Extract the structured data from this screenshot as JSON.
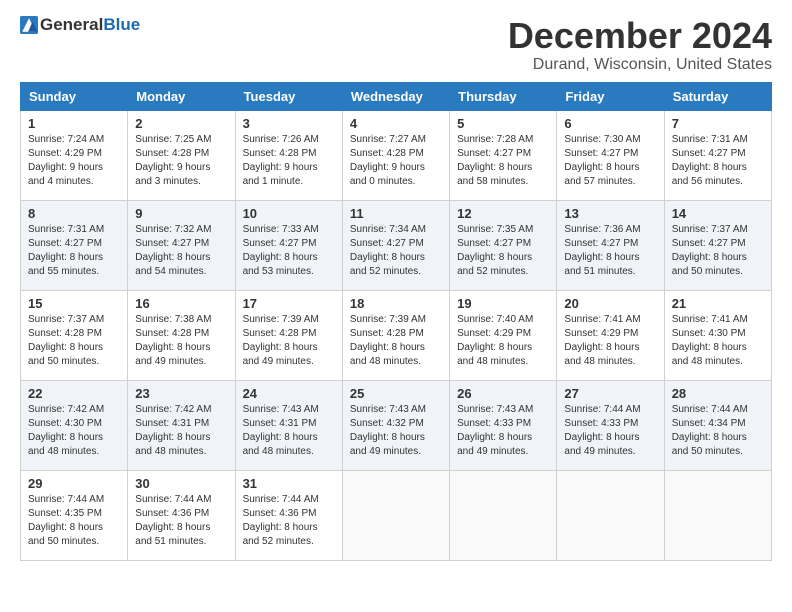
{
  "logo": {
    "general": "General",
    "blue": "Blue"
  },
  "header": {
    "month": "December 2024",
    "location": "Durand, Wisconsin, United States"
  },
  "weekdays": [
    "Sunday",
    "Monday",
    "Tuesday",
    "Wednesday",
    "Thursday",
    "Friday",
    "Saturday"
  ],
  "weeks": [
    [
      {
        "day": "1",
        "sunrise": "Sunrise: 7:24 AM",
        "sunset": "Sunset: 4:29 PM",
        "daylight": "Daylight: 9 hours and 4 minutes."
      },
      {
        "day": "2",
        "sunrise": "Sunrise: 7:25 AM",
        "sunset": "Sunset: 4:28 PM",
        "daylight": "Daylight: 9 hours and 3 minutes."
      },
      {
        "day": "3",
        "sunrise": "Sunrise: 7:26 AM",
        "sunset": "Sunset: 4:28 PM",
        "daylight": "Daylight: 9 hours and 1 minute."
      },
      {
        "day": "4",
        "sunrise": "Sunrise: 7:27 AM",
        "sunset": "Sunset: 4:28 PM",
        "daylight": "Daylight: 9 hours and 0 minutes."
      },
      {
        "day": "5",
        "sunrise": "Sunrise: 7:28 AM",
        "sunset": "Sunset: 4:27 PM",
        "daylight": "Daylight: 8 hours and 58 minutes."
      },
      {
        "day": "6",
        "sunrise": "Sunrise: 7:30 AM",
        "sunset": "Sunset: 4:27 PM",
        "daylight": "Daylight: 8 hours and 57 minutes."
      },
      {
        "day": "7",
        "sunrise": "Sunrise: 7:31 AM",
        "sunset": "Sunset: 4:27 PM",
        "daylight": "Daylight: 8 hours and 56 minutes."
      }
    ],
    [
      {
        "day": "8",
        "sunrise": "Sunrise: 7:31 AM",
        "sunset": "Sunset: 4:27 PM",
        "daylight": "Daylight: 8 hours and 55 minutes."
      },
      {
        "day": "9",
        "sunrise": "Sunrise: 7:32 AM",
        "sunset": "Sunset: 4:27 PM",
        "daylight": "Daylight: 8 hours and 54 minutes."
      },
      {
        "day": "10",
        "sunrise": "Sunrise: 7:33 AM",
        "sunset": "Sunset: 4:27 PM",
        "daylight": "Daylight: 8 hours and 53 minutes."
      },
      {
        "day": "11",
        "sunrise": "Sunrise: 7:34 AM",
        "sunset": "Sunset: 4:27 PM",
        "daylight": "Daylight: 8 hours and 52 minutes."
      },
      {
        "day": "12",
        "sunrise": "Sunrise: 7:35 AM",
        "sunset": "Sunset: 4:27 PM",
        "daylight": "Daylight: 8 hours and 52 minutes."
      },
      {
        "day": "13",
        "sunrise": "Sunrise: 7:36 AM",
        "sunset": "Sunset: 4:27 PM",
        "daylight": "Daylight: 8 hours and 51 minutes."
      },
      {
        "day": "14",
        "sunrise": "Sunrise: 7:37 AM",
        "sunset": "Sunset: 4:27 PM",
        "daylight": "Daylight: 8 hours and 50 minutes."
      }
    ],
    [
      {
        "day": "15",
        "sunrise": "Sunrise: 7:37 AM",
        "sunset": "Sunset: 4:28 PM",
        "daylight": "Daylight: 8 hours and 50 minutes."
      },
      {
        "day": "16",
        "sunrise": "Sunrise: 7:38 AM",
        "sunset": "Sunset: 4:28 PM",
        "daylight": "Daylight: 8 hours and 49 minutes."
      },
      {
        "day": "17",
        "sunrise": "Sunrise: 7:39 AM",
        "sunset": "Sunset: 4:28 PM",
        "daylight": "Daylight: 8 hours and 49 minutes."
      },
      {
        "day": "18",
        "sunrise": "Sunrise: 7:39 AM",
        "sunset": "Sunset: 4:28 PM",
        "daylight": "Daylight: 8 hours and 48 minutes."
      },
      {
        "day": "19",
        "sunrise": "Sunrise: 7:40 AM",
        "sunset": "Sunset: 4:29 PM",
        "daylight": "Daylight: 8 hours and 48 minutes."
      },
      {
        "day": "20",
        "sunrise": "Sunrise: 7:41 AM",
        "sunset": "Sunset: 4:29 PM",
        "daylight": "Daylight: 8 hours and 48 minutes."
      },
      {
        "day": "21",
        "sunrise": "Sunrise: 7:41 AM",
        "sunset": "Sunset: 4:30 PM",
        "daylight": "Daylight: 8 hours and 48 minutes."
      }
    ],
    [
      {
        "day": "22",
        "sunrise": "Sunrise: 7:42 AM",
        "sunset": "Sunset: 4:30 PM",
        "daylight": "Daylight: 8 hours and 48 minutes."
      },
      {
        "day": "23",
        "sunrise": "Sunrise: 7:42 AM",
        "sunset": "Sunset: 4:31 PM",
        "daylight": "Daylight: 8 hours and 48 minutes."
      },
      {
        "day": "24",
        "sunrise": "Sunrise: 7:43 AM",
        "sunset": "Sunset: 4:31 PM",
        "daylight": "Daylight: 8 hours and 48 minutes."
      },
      {
        "day": "25",
        "sunrise": "Sunrise: 7:43 AM",
        "sunset": "Sunset: 4:32 PM",
        "daylight": "Daylight: 8 hours and 49 minutes."
      },
      {
        "day": "26",
        "sunrise": "Sunrise: 7:43 AM",
        "sunset": "Sunset: 4:33 PM",
        "daylight": "Daylight: 8 hours and 49 minutes."
      },
      {
        "day": "27",
        "sunrise": "Sunrise: 7:44 AM",
        "sunset": "Sunset: 4:33 PM",
        "daylight": "Daylight: 8 hours and 49 minutes."
      },
      {
        "day": "28",
        "sunrise": "Sunrise: 7:44 AM",
        "sunset": "Sunset: 4:34 PM",
        "daylight": "Daylight: 8 hours and 50 minutes."
      }
    ],
    [
      {
        "day": "29",
        "sunrise": "Sunrise: 7:44 AM",
        "sunset": "Sunset: 4:35 PM",
        "daylight": "Daylight: 8 hours and 50 minutes."
      },
      {
        "day": "30",
        "sunrise": "Sunrise: 7:44 AM",
        "sunset": "Sunset: 4:36 PM",
        "daylight": "Daylight: 8 hours and 51 minutes."
      },
      {
        "day": "31",
        "sunrise": "Sunrise: 7:44 AM",
        "sunset": "Sunset: 4:36 PM",
        "daylight": "Daylight: 8 hours and 52 minutes."
      },
      null,
      null,
      null,
      null
    ]
  ]
}
